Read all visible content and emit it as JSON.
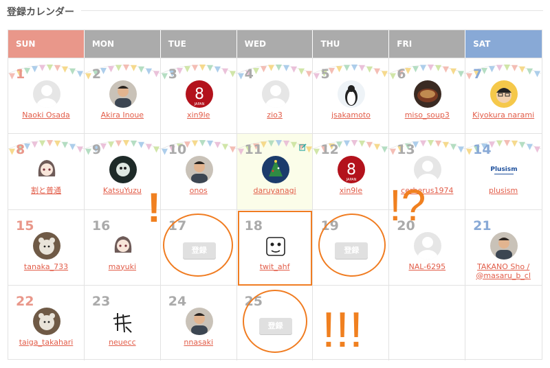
{
  "section_title": "登録カレンダー",
  "weekdays": [
    "SUN",
    "MON",
    "TUE",
    "WED",
    "THU",
    "FRI",
    "SAT"
  ],
  "register_label": "登録",
  "weeks": [
    [
      {
        "day": "1",
        "user": "Naoki Osada",
        "avatar": "default-avatar"
      },
      {
        "day": "2",
        "user": "Akira Inoue",
        "avatar": "photo-avatar"
      },
      {
        "day": "3",
        "user": "xin9le",
        "avatar": "red-logo-avatar"
      },
      {
        "day": "4",
        "user": "zio3",
        "avatar": "default-avatar"
      },
      {
        "day": "5",
        "user": "jsakamoto",
        "avatar": "penguin-avatar"
      },
      {
        "day": "6",
        "user": "miso_soup3",
        "avatar": "soup-avatar"
      },
      {
        "day": "7",
        "user": "Kiyokura narami",
        "avatar": "cartoon-avatar"
      }
    ],
    [
      {
        "day": "8",
        "user": "割と普通",
        "avatar": "anime-avatar"
      },
      {
        "day": "9",
        "user": "KatsuYuzu",
        "avatar": "dark-avatar"
      },
      {
        "day": "10",
        "user": "onos",
        "avatar": "photo-avatar"
      },
      {
        "day": "11",
        "user": "daruyanagi",
        "avatar": "tree-avatar"
      },
      {
        "day": "12",
        "user": "xin9le",
        "avatar": "red-logo-avatar"
      },
      {
        "day": "13",
        "user": "cerberus1974",
        "avatar": "default-avatar"
      },
      {
        "day": "14",
        "user": "plusism",
        "avatar": "plusism-logo"
      }
    ],
    [
      {
        "day": "15",
        "user": "tanaka_733",
        "avatar": "animal-avatar"
      },
      {
        "day": "16",
        "user": "mayuki",
        "avatar": "anime-avatar"
      },
      {
        "day": "17",
        "user": "",
        "avatar": ""
      },
      {
        "day": "18",
        "user": "twit_ahf",
        "avatar": "sketch-avatar"
      },
      {
        "day": "19",
        "user": "",
        "avatar": ""
      },
      {
        "day": "20",
        "user": "NAL-6295",
        "avatar": "default-avatar"
      },
      {
        "day": "21",
        "user": "TAKANO Sho / @masaru_b_cl",
        "avatar": "photo-avatar"
      }
    ],
    [
      {
        "day": "22",
        "user": "taiga_takahari",
        "avatar": "animal-avatar"
      },
      {
        "day": "23",
        "user": "neuecc",
        "avatar": "kanji-avatar"
      },
      {
        "day": "24",
        "user": "nnasaki",
        "avatar": "photo-avatar"
      },
      {
        "day": "25",
        "user": "",
        "avatar": ""
      },
      {
        "day": "",
        "user": "",
        "avatar": ""
      },
      {
        "day": "",
        "user": "",
        "avatar": ""
      },
      {
        "day": "",
        "user": "",
        "avatar": ""
      }
    ]
  ],
  "annotations": {
    "exclaim_single": "!",
    "exclaim_question": "!?",
    "exclaim_triple": "!!!"
  },
  "colors": {
    "sunday": "#e9978a",
    "saturday": "#88a9d6",
    "weekday_header": "#ababab",
    "link": "#e25c48",
    "accent_orange": "#f07c21"
  }
}
